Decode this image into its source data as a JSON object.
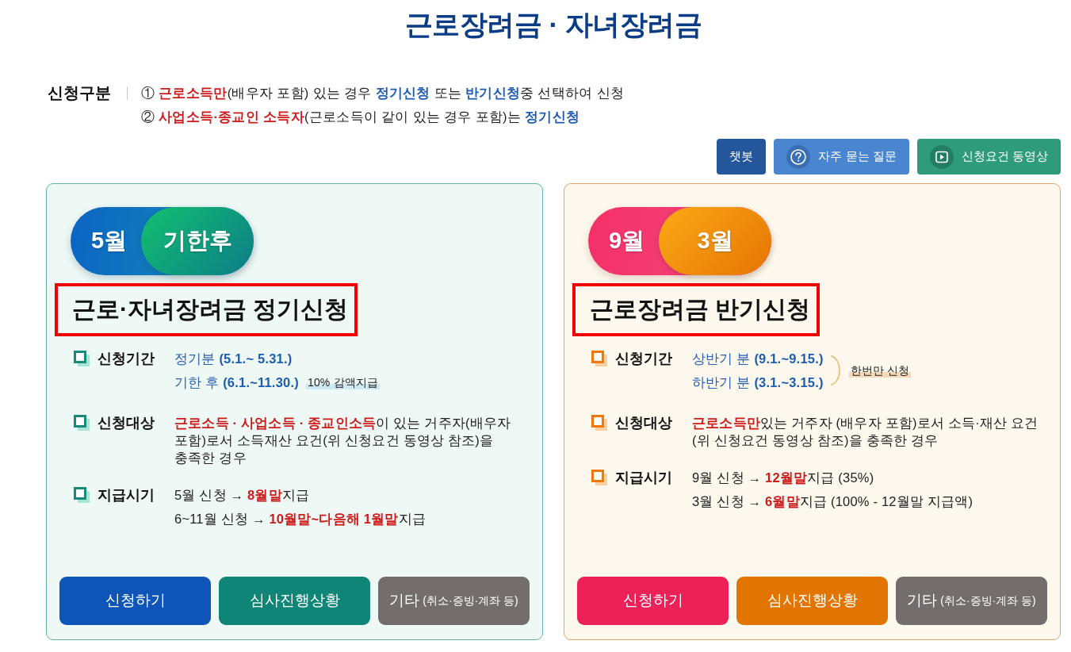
{
  "page_title": "근로장려금 · 자녀장려금",
  "application_type": {
    "label": "신청구분",
    "lines": [
      {
        "segments": [
          {
            "kind": "plain",
            "text": "① "
          },
          {
            "kind": "alert",
            "text": "근로소득만"
          },
          {
            "kind": "plain",
            "text": "(배우자 포함) 있는 경우 "
          },
          {
            "kind": "term",
            "text": "정기신청"
          },
          {
            "kind": "plain",
            "text": " 또는 "
          },
          {
            "kind": "term",
            "text": "반기신청"
          },
          {
            "kind": "plain",
            "text": "중 선택하여 신청"
          }
        ]
      },
      {
        "segments": [
          {
            "kind": "plain",
            "text": "② "
          },
          {
            "kind": "alert",
            "text": "사업소득·종교인 소득자"
          },
          {
            "kind": "plain",
            "text": "(근로소득이 같이 있는 경우 포함)는 "
          },
          {
            "kind": "term",
            "text": "정기신청"
          }
        ]
      }
    ]
  },
  "quick_buttons": [
    {
      "kind": "chat",
      "label": "챗봇"
    },
    {
      "kind": "faq",
      "label": "자주 묻는 질문"
    },
    {
      "kind": "video",
      "label": "신청요건 동영상"
    }
  ],
  "cards": [
    {
      "kind": "regular",
      "badges": [
        "5월",
        "기한후"
      ],
      "title": "근로·자녀장려금 정기신청",
      "title_highlighted": true,
      "rows": [
        {
          "kind": "lines",
          "label": "신청기간",
          "lines": [
            {
              "segments": [
                {
                  "kind": "period",
                  "text": "정기분 "
                },
                {
                  "kind": "term",
                  "text": "(5.1.~ 5.31.)"
                }
              ]
            },
            {
              "segments": [
                {
                  "kind": "period",
                  "text": "기한 후 "
                },
                {
                  "kind": "term",
                  "text": "(6.1.~11.30.)"
                }
              ],
              "note": "10% 감액지급"
            }
          ]
        },
        {
          "kind": "paragraph",
          "label": "신청대상",
          "lines": [
            {
              "segments": [
                {
                  "kind": "alert",
                  "text": "근로소득 · 사업소득 · 종교인소득"
                },
                {
                  "kind": "plain",
                  "text": "이 있는 거주자(배우자 포함)로서 소득재산 요건(위 신청요건 동영상 참조)을 충족한 경우"
                }
              ]
            }
          ]
        },
        {
          "kind": "lines",
          "label": "지급시기",
          "lines": [
            {
              "segments": [
                {
                  "kind": "plain",
                  "text": "5월 신청 → "
                },
                {
                  "kind": "alert",
                  "text": "8월말"
                },
                {
                  "kind": "plain",
                  "text": "지급"
                }
              ]
            },
            {
              "segments": [
                {
                  "kind": "plain",
                  "text": "6~11월 신청 → "
                },
                {
                  "kind": "alert",
                  "text": "10월말~다음해 1월말"
                },
                {
                  "kind": "plain",
                  "text": "지급"
                }
              ]
            }
          ]
        }
      ],
      "buttons": [
        {
          "kind": "apply",
          "label": "신청하기"
        },
        {
          "kind": "status",
          "label": "심사진행상황"
        },
        {
          "kind": "other",
          "label": "기타",
          "sub_label": "(취소·증빙·계좌 등)"
        }
      ]
    },
    {
      "kind": "semiannual",
      "badges": [
        "9월",
        "3월"
      ],
      "title": "근로장려금 반기신청",
      "title_highlighted": true,
      "rows": [
        {
          "kind": "lines",
          "label": "신청기간",
          "side_note": "한번만 신청",
          "lines": [
            {
              "segments": [
                {
                  "kind": "period",
                  "text": "상반기 분 "
                },
                {
                  "kind": "term",
                  "text": "(9.1.~9.15.)"
                }
              ]
            },
            {
              "segments": [
                {
                  "kind": "period",
                  "text": "하반기 분 "
                },
                {
                  "kind": "term",
                  "text": "(3.1.~3.15.)"
                }
              ]
            }
          ]
        },
        {
          "kind": "paragraph",
          "label": "신청대상",
          "lines": [
            {
              "segments": [
                {
                  "kind": "alert",
                  "text": "근로소득만"
                },
                {
                  "kind": "plain",
                  "text": "있는 거주자 (배우자 포함)로서 소득·재산 요건 (위 신청요건 동영상 참조)을 충족한 경우"
                }
              ]
            }
          ]
        },
        {
          "kind": "lines",
          "label": "지급시기",
          "lines": [
            {
              "segments": [
                {
                  "kind": "plain",
                  "text": "9월 신청 → "
                },
                {
                  "kind": "alert",
                  "text": "12월말"
                },
                {
                  "kind": "plain",
                  "text": "지급 (35%)"
                }
              ]
            },
            {
              "segments": [
                {
                  "kind": "plain",
                  "text": "3월 신청 → "
                },
                {
                  "kind": "alert",
                  "text": "6월말"
                },
                {
                  "kind": "plain",
                  "text": "지급 (100% - 12월말 지급액)"
                }
              ]
            }
          ]
        }
      ],
      "buttons": [
        {
          "kind": "apply",
          "label": "신청하기"
        },
        {
          "kind": "status",
          "label": "심사진행상황"
        },
        {
          "kind": "other",
          "label": "기타",
          "sub_label": "(취소·증빙·계좌 등)"
        }
      ]
    }
  ]
}
